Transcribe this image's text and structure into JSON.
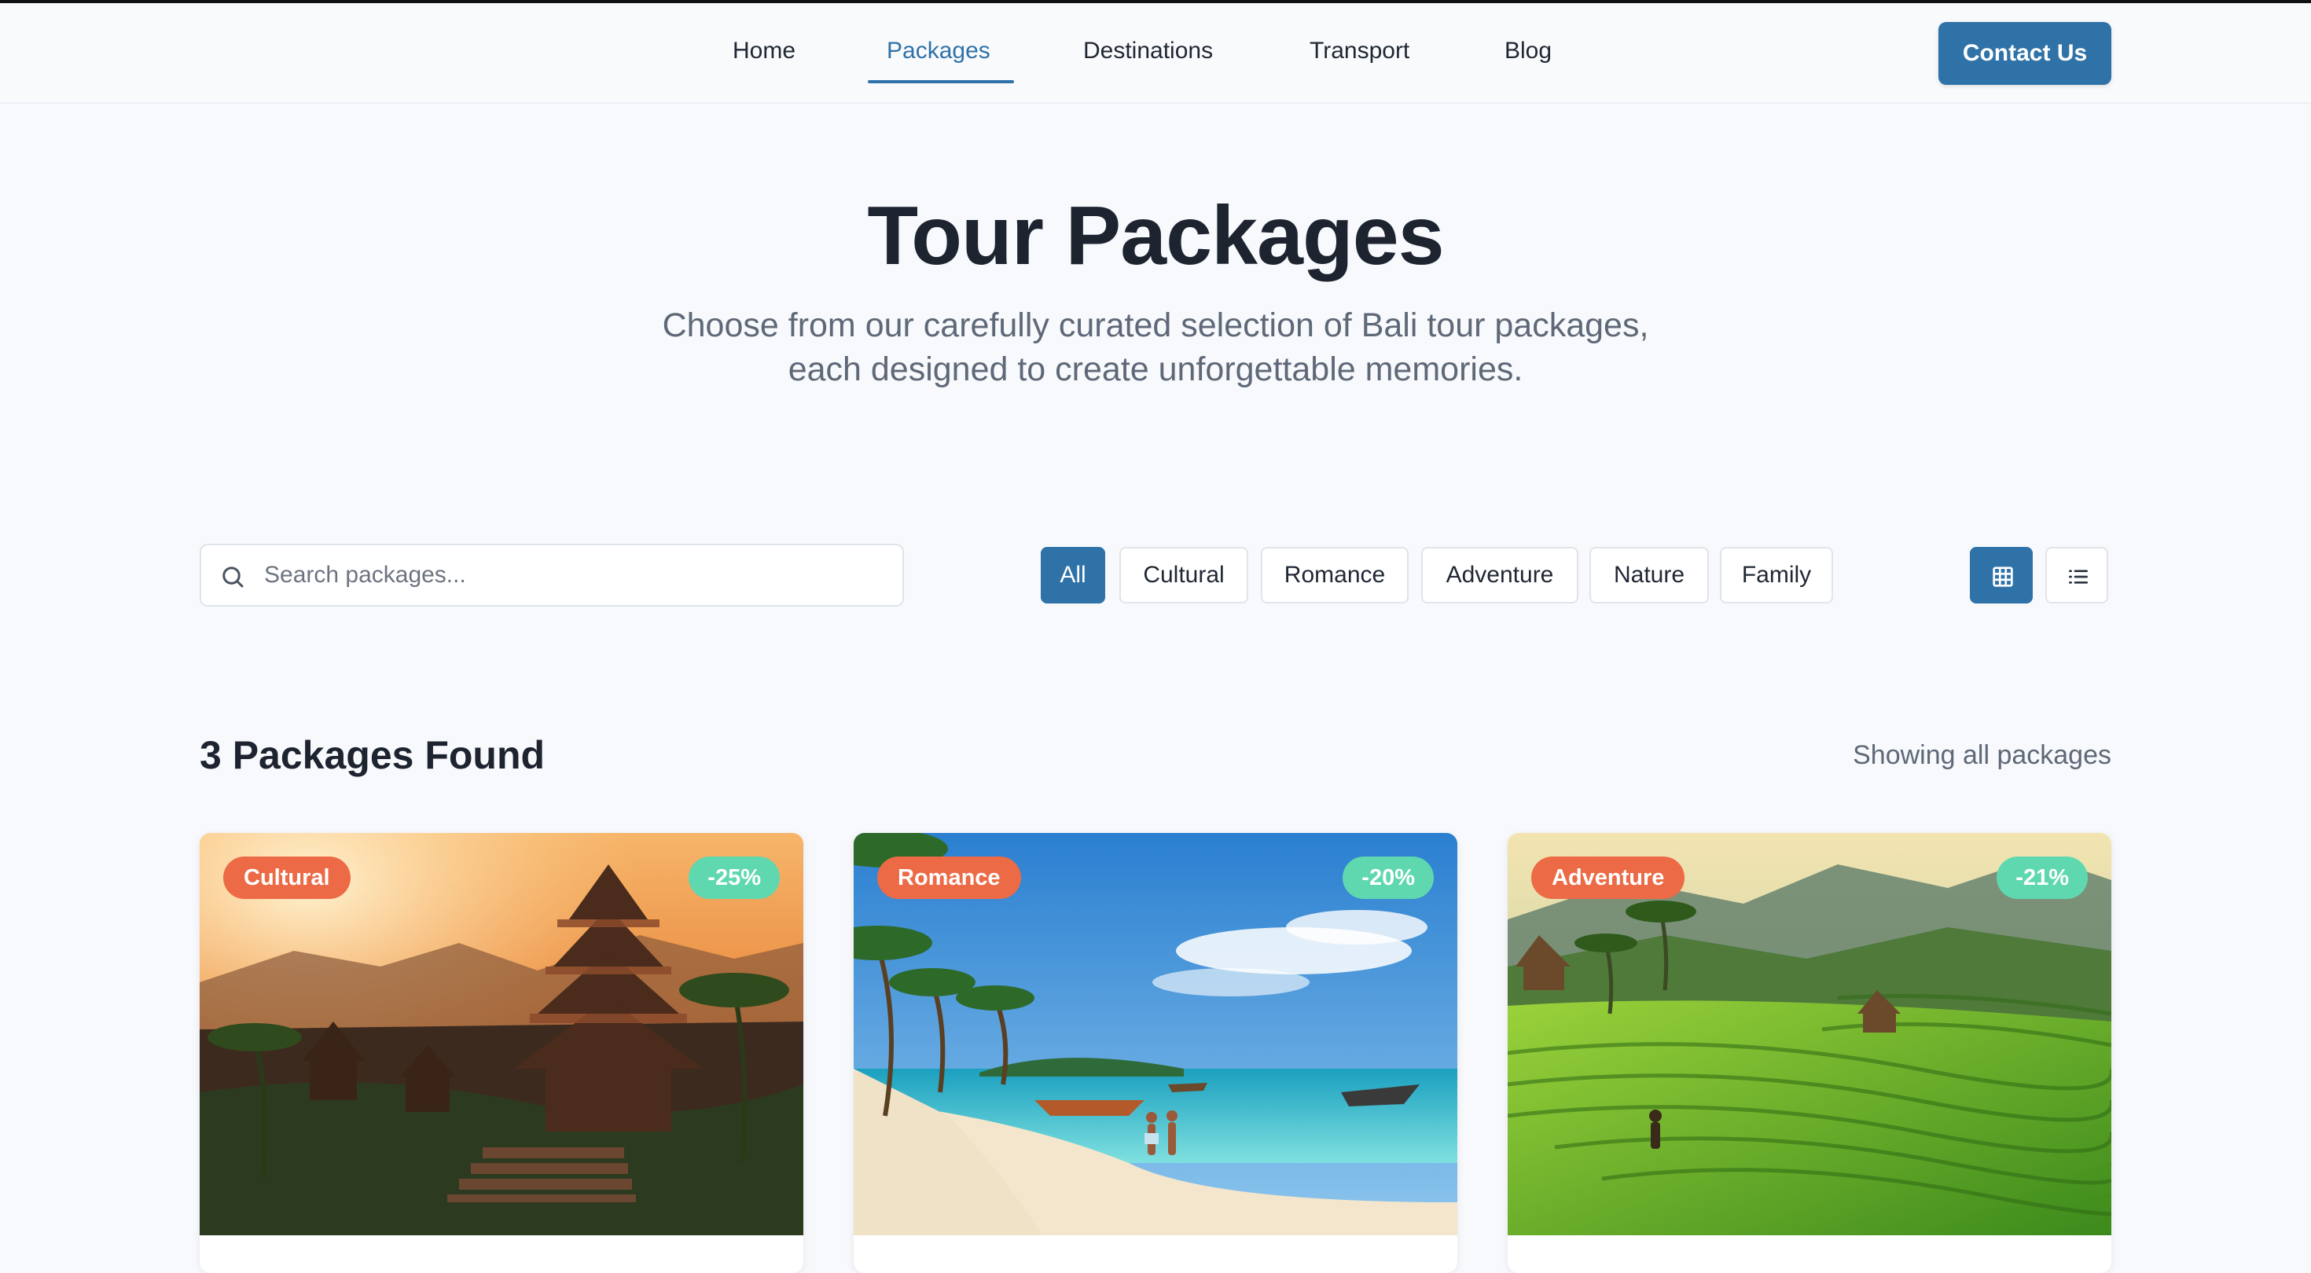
{
  "nav": {
    "links": [
      "Home",
      "Packages",
      "Destinations",
      "Transport",
      "Blog"
    ],
    "active": "Packages",
    "contact_label": "Contact Us"
  },
  "hero": {
    "title": "Tour Packages",
    "subtitle_line1": "Choose from our carefully curated selection of Bali tour packages,",
    "subtitle_line2": "each designed to create unforgettable memories."
  },
  "filters": {
    "search_placeholder": "Search packages...",
    "categories": [
      "All",
      "Cultural",
      "Romance",
      "Adventure",
      "Nature",
      "Family"
    ],
    "active_category": "All",
    "view_modes": [
      "grid-view-icon",
      "list-view-icon"
    ],
    "active_view": "grid"
  },
  "results": {
    "title": "3 Packages Found",
    "status": "Showing all packages"
  },
  "packages": [
    {
      "category": "Cultural",
      "discount": "-25%",
      "image": "temple-sunset"
    },
    {
      "category": "Romance",
      "discount": "-20%",
      "image": "beach-couple"
    },
    {
      "category": "Adventure",
      "discount": "-21%",
      "image": "rice-terraces"
    }
  ],
  "colors": {
    "accent": "#2f72a8",
    "category_badge": "#ec6a45",
    "discount_badge": "#5fd8b0",
    "page_bg": "#f7f9fc"
  }
}
